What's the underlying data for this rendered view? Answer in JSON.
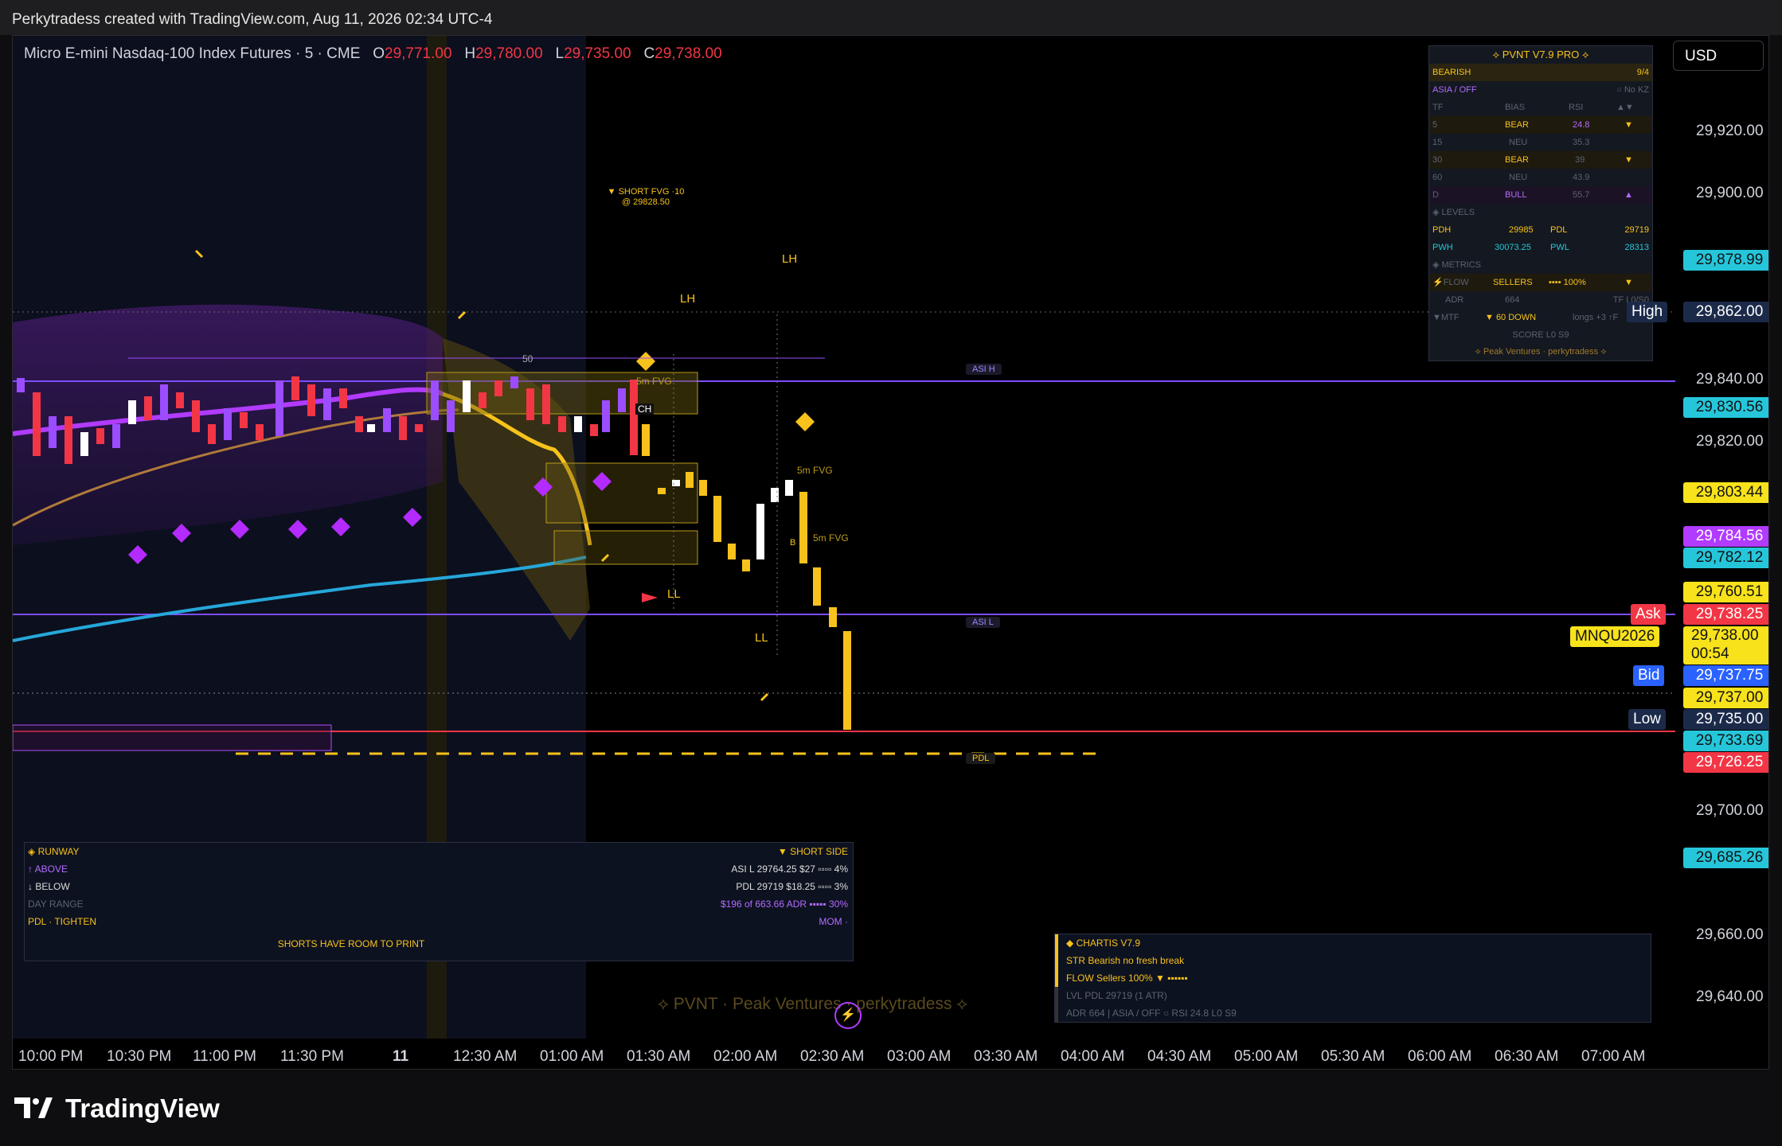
{
  "header": {
    "credit": "Perkytradess created with TradingView.com, Aug 11, 2026 02:34 UTC-4"
  },
  "legend": {
    "symbol": "Micro E-mini Nasdaq-100 Index Futures · 5 · CME",
    "o_label": "O",
    "o": "29,771.00",
    "h_label": "H",
    "h": "29,780.00",
    "l_label": "L",
    "l": "29,735.00",
    "c_label": "C",
    "c": "29,738.00"
  },
  "currency": "USD",
  "price_scale": {
    "ticks": [
      "29,920.00",
      "29,900.00",
      "29,840.00",
      "29,820.00",
      "29,700.00",
      "29,660.00",
      "29,640.00"
    ],
    "tags": {
      "t878": "29,878.99",
      "high_label": "High",
      "high": "29,862.00",
      "t830": "29,830.56",
      "t803": "29,803.44",
      "t784": "29,784.56",
      "t782": "29,782.12",
      "t760": "29,760.51",
      "ask_label": "Ask",
      "ask": "29,738.25",
      "symbol_code": "MNQU2026",
      "last": "29,738.00",
      "countdown": "00:54",
      "bid_label": "Bid",
      "bid": "29,737.75",
      "t737": "29,737.00",
      "low_label": "Low",
      "low": "29,735.00",
      "t733": "29,733.69",
      "t726": "29,726.25",
      "t685": "29,685.26"
    }
  },
  "time_axis": [
    "10:00 PM",
    "10:30 PM",
    "11:00 PM",
    "11:30 PM",
    "11",
    "12:30 AM",
    "01:00 AM",
    "01:30 AM",
    "02:00 AM",
    "02:30 AM",
    "03:00 AM",
    "03:30 AM",
    "04:00 AM",
    "04:30 AM",
    "05:00 AM",
    "05:30 AM",
    "06:00 AM",
    "06:30 AM",
    "07:00 AM"
  ],
  "annotations": {
    "short_fvg": "▼ SHORT FVG ·10",
    "short_fvg_price": "@ 29828.50",
    "lh1": "LH",
    "lh2": "LH",
    "ll1": "LL",
    "ll2": "LL",
    "asi_h": "ASI H",
    "asi_l": "ASI L",
    "pdl": "PDL",
    "fvg1": "5m FVG",
    "fvg2": "5m FVG",
    "fvg3": "5m FVG",
    "ch": "CH",
    "b": "B",
    "fifty": "50"
  },
  "pvnt": {
    "title": "⟡ PVNT  V7.9  PRO ⟡",
    "state": "BEARISH",
    "state_count": "9/4",
    "session": "ASIA / OFF",
    "kz": "○ No KZ",
    "cols": [
      "TF",
      "BIAS",
      "RSI",
      "▲▼"
    ],
    "rows": [
      {
        "tf": "5",
        "bias": "BEAR",
        "rsi": "24.8",
        "arrow": "▼"
      },
      {
        "tf": "15",
        "bias": "NEU",
        "rsi": "35.3",
        "arrow": ""
      },
      {
        "tf": "30",
        "bias": "BEAR",
        "rsi": "39",
        "arrow": "▼"
      },
      {
        "tf": "60",
        "bias": "NEU",
        "rsi": "43.9",
        "arrow": ""
      },
      {
        "tf": "D",
        "bias": "BULL",
        "rsi": "55.7",
        "arrow": "▲"
      }
    ],
    "levels_label": "◈ LEVELS",
    "pdh_label": "PDH",
    "pdh": "29985",
    "pdl_label": "PDL",
    "pdl": "29719",
    "pwh_label": "PWH",
    "pwh": "30073.25",
    "pwl_label": "PWL",
    "pwl": "28313",
    "metrics_label": "◈ METRICS",
    "flow_label": "⚡FLOW",
    "flow": "SELLERS",
    "flow_pct": "▪▪▪▪ 100%",
    "flow_arrow": "▼",
    "adr_label": "ADR",
    "adr": "664",
    "tf_label": "TF L0/S0",
    "mtf_label": "▼MTF",
    "mtf": "▼ 60 DOWN",
    "longs": "longs +3 ↑F",
    "score": "SCORE  L0  S9",
    "footer": "⟡ Peak Ventures · perkytradess ⟡"
  },
  "runway": {
    "title": "◈ RUNWAY",
    "side": "▼ SHORT SIDE",
    "above_label": "↑ ABOVE",
    "above": "ASI L 29764.25  $27  ▫▫▫▫ 4%",
    "below_label": "↓ BELOW",
    "below": "PDL 29719  $18.25  ▫▫▫▫ 3%",
    "range_label": "DAY RANGE",
    "range": "$196 of 663.66 ADR  ▪▪▪▪▪ 30%",
    "pdl_label": "PDL · TIGHTEN",
    "mom": "MOM ·",
    "message": "SHORTS HAVE ROOM TO PRINT"
  },
  "chartis": {
    "title": "◆ CHARTIS  V7.9",
    "str": "STR  Bearish  no fresh break",
    "flow": "FLOW  Sellers  100% ▼  ▪▪▪▪▪▪",
    "lvl": "LVL  PDL  29719  (1 ATR)",
    "adr": "ADR  664  |  ASIA / OFF  ○  RSI 24.8  L0  S9"
  },
  "watermark": "⟡  PVNT  ·  Peak Ventures  ·  perkytradess  ⟡",
  "brand": "TradingView",
  "colors": {
    "bull": "#9b4dff",
    "bear": "#f23645",
    "accent": "#f7c21b",
    "cyan": "#26c6da",
    "purple": "#7c4dff"
  }
}
